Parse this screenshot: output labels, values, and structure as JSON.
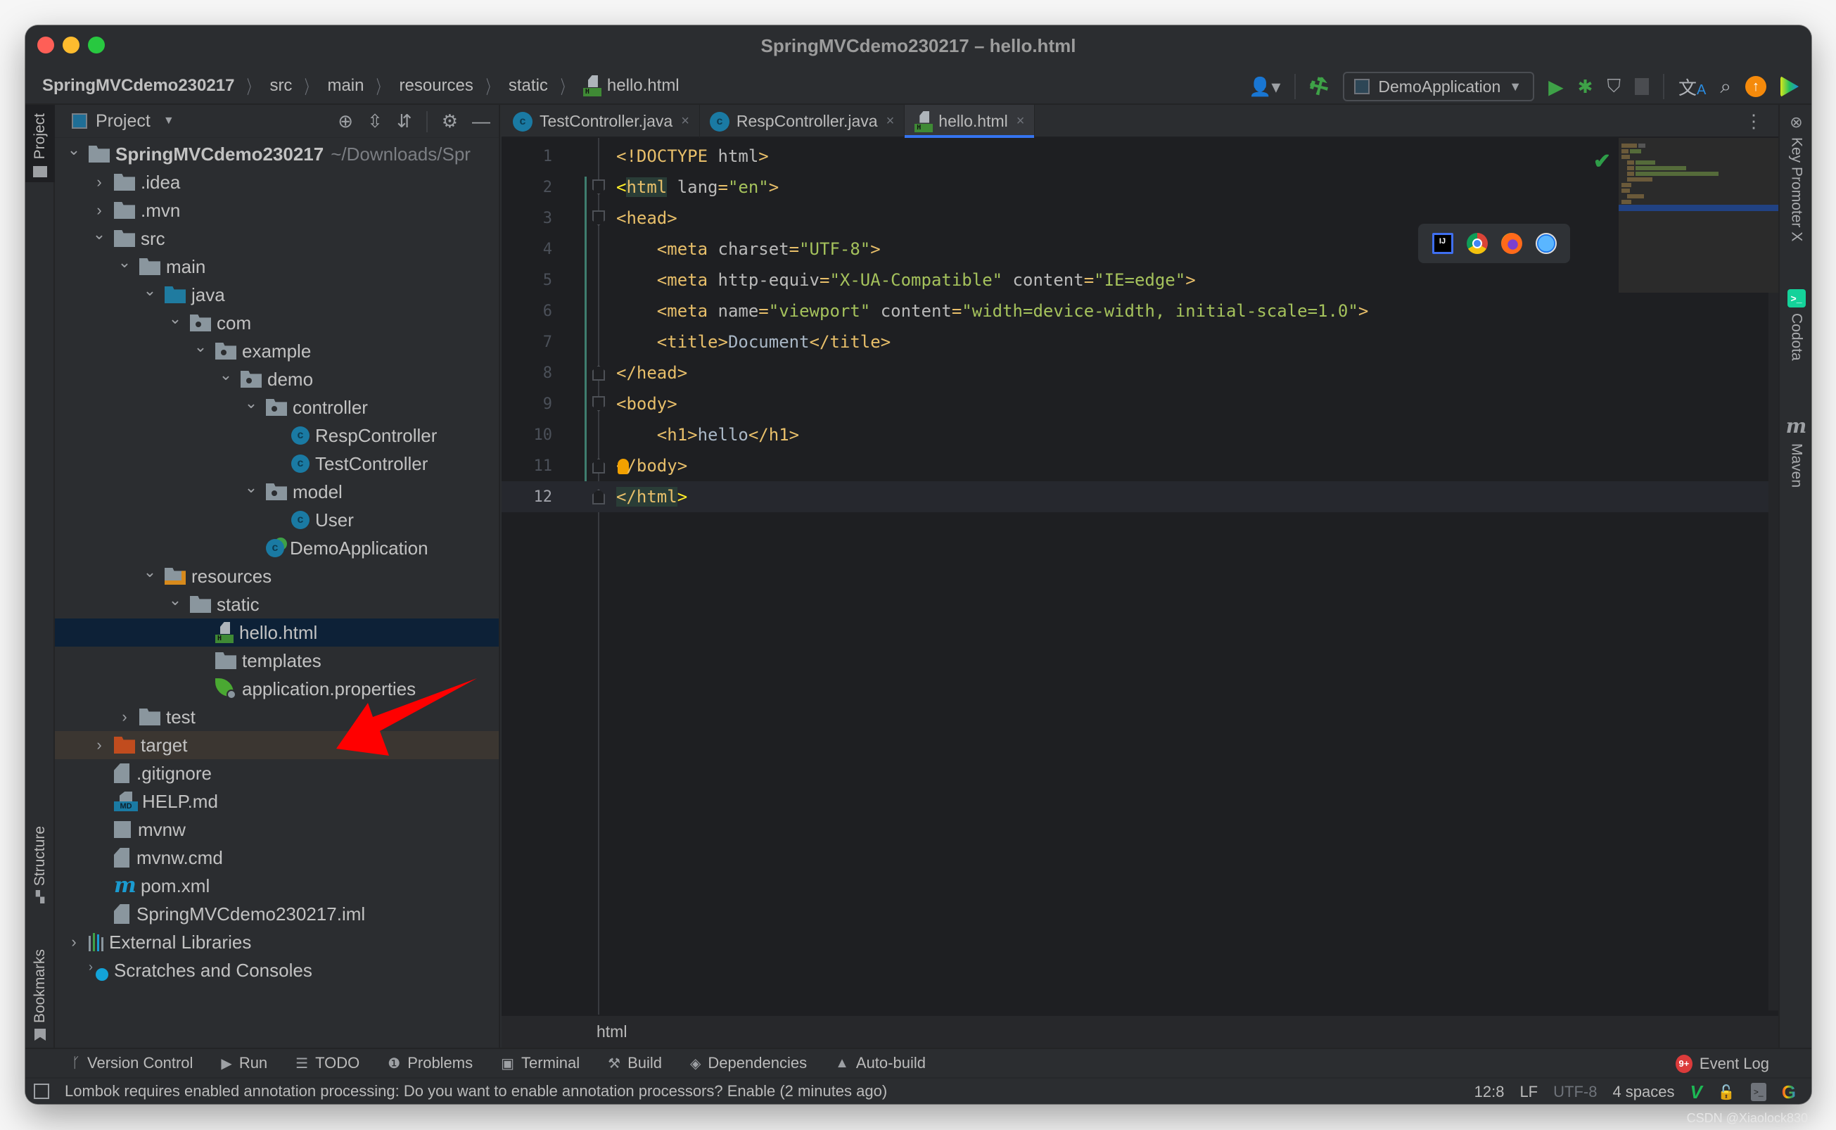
{
  "window": {
    "title": "SpringMVCdemo230217 – hello.html"
  },
  "navbar": {
    "breadcrumbs": [
      "SpringMVCdemo230217",
      "src",
      "main",
      "resources",
      "static",
      "hello.html"
    ],
    "run_config": "DemoApplication"
  },
  "left_stripe": {
    "project": "Project",
    "structure": "Structure",
    "bookmarks": "Bookmarks"
  },
  "right_stripe": {
    "key_promoter": "Key Promoter X",
    "codota": "Codota",
    "maven": "Maven"
  },
  "project_panel": {
    "title": "Project",
    "tree": [
      {
        "label": "SpringMVCdemo230217",
        "suffix": "~/Downloads/Spr",
        "depth": 0,
        "expanded": true,
        "icon": "module-folder"
      },
      {
        "label": ".idea",
        "depth": 1,
        "expanded": false,
        "icon": "folder"
      },
      {
        "label": ".mvn",
        "depth": 1,
        "expanded": false,
        "icon": "folder"
      },
      {
        "label": "src",
        "depth": 1,
        "expanded": true,
        "icon": "folder"
      },
      {
        "label": "main",
        "depth": 2,
        "expanded": true,
        "icon": "folder"
      },
      {
        "label": "java",
        "depth": 3,
        "expanded": true,
        "icon": "source-folder"
      },
      {
        "label": "com",
        "depth": 4,
        "expanded": true,
        "icon": "package"
      },
      {
        "label": "example",
        "depth": 5,
        "expanded": true,
        "icon": "package"
      },
      {
        "label": "demo",
        "depth": 6,
        "expanded": true,
        "icon": "package"
      },
      {
        "label": "controller",
        "depth": 7,
        "expanded": true,
        "icon": "package"
      },
      {
        "label": "RespController",
        "depth": 8,
        "icon": "class"
      },
      {
        "label": "TestController",
        "depth": 8,
        "icon": "class"
      },
      {
        "label": "model",
        "depth": 7,
        "expanded": true,
        "icon": "package"
      },
      {
        "label": "User",
        "depth": 8,
        "icon": "class"
      },
      {
        "label": "DemoApplication",
        "depth": 7,
        "icon": "class-run"
      },
      {
        "label": "resources",
        "depth": 3,
        "expanded": true,
        "icon": "resources-folder"
      },
      {
        "label": "static",
        "depth": 4,
        "expanded": true,
        "icon": "folder"
      },
      {
        "label": "hello.html",
        "depth": 5,
        "icon": "html",
        "selected": true
      },
      {
        "label": "templates",
        "depth": 5,
        "icon": "folder"
      },
      {
        "label": "application.properties",
        "depth": 5,
        "icon": "spring-properties"
      },
      {
        "label": "test",
        "depth": 2,
        "expanded": false,
        "icon": "folder"
      },
      {
        "label": "target",
        "depth": 1,
        "expanded": false,
        "icon": "excluded-folder",
        "excluded": true
      },
      {
        "label": ".gitignore",
        "depth": 1,
        "icon": "ignore-file"
      },
      {
        "label": "HELP.md",
        "depth": 1,
        "icon": "markdown"
      },
      {
        "label": "mvnw",
        "depth": 1,
        "icon": "shell"
      },
      {
        "label": "mvnw.cmd",
        "depth": 1,
        "icon": "text-file"
      },
      {
        "label": "pom.xml",
        "depth": 1,
        "icon": "maven"
      },
      {
        "label": "SpringMVCdemo230217.iml",
        "depth": 1,
        "icon": "iml-file"
      },
      {
        "label": "External Libraries",
        "depth": 0,
        "expanded": false,
        "icon": "libraries"
      },
      {
        "label": "Scratches and Consoles",
        "depth": 0,
        "icon": "scratches"
      }
    ]
  },
  "editor": {
    "tabs": [
      {
        "label": "TestController.java",
        "icon": "class",
        "active": false
      },
      {
        "label": "RespController.java",
        "icon": "class",
        "active": false
      },
      {
        "label": "hello.html",
        "icon": "html",
        "active": true
      }
    ],
    "lines": [
      {
        "n": "1",
        "tokens": [
          [
            "tg",
            "<!DOCTYPE"
          ],
          [
            "at",
            " html"
          ],
          [
            "tg",
            ">"
          ]
        ]
      },
      {
        "n": "2",
        "tokens": [
          [
            "tgy",
            "<"
          ],
          [
            "tgh",
            "html"
          ],
          [
            "at",
            " lang"
          ],
          [
            "tg",
            "="
          ],
          [
            "av",
            "\"en\""
          ],
          [
            "tg",
            ">"
          ]
        ],
        "fold": "open"
      },
      {
        "n": "3",
        "tokens": [
          [
            "tg",
            "<head>"
          ]
        ],
        "fold": "open"
      },
      {
        "n": "4",
        "tokens": [
          [
            "tg",
            "    <meta"
          ],
          [
            "at",
            " charset"
          ],
          [
            "tg",
            "="
          ],
          [
            "av",
            "\"UTF-8\""
          ],
          [
            "tg",
            ">"
          ]
        ]
      },
      {
        "n": "5",
        "tokens": [
          [
            "tg",
            "    <meta"
          ],
          [
            "at",
            " http-equiv"
          ],
          [
            "tg",
            "="
          ],
          [
            "av",
            "\"X-UA-Compatible\""
          ],
          [
            "at",
            " content"
          ],
          [
            "tg",
            "="
          ],
          [
            "av",
            "\"IE=edge\""
          ],
          [
            "tg",
            ">"
          ]
        ]
      },
      {
        "n": "6",
        "tokens": [
          [
            "tg",
            "    <meta"
          ],
          [
            "at",
            " name"
          ],
          [
            "tg",
            "="
          ],
          [
            "av",
            "\"viewport\""
          ],
          [
            "at",
            " content"
          ],
          [
            "tg",
            "="
          ],
          [
            "av",
            "\"width=device-width, initial-scale=1.0\""
          ],
          [
            "tg",
            ">"
          ]
        ]
      },
      {
        "n": "7",
        "tokens": [
          [
            "tg",
            "    <title>"
          ],
          [
            "tx",
            "Document"
          ],
          [
            "tg",
            "</title>"
          ]
        ]
      },
      {
        "n": "8",
        "tokens": [
          [
            "tg",
            "</head>"
          ]
        ],
        "fold": "close"
      },
      {
        "n": "9",
        "tokens": [
          [
            "tg",
            "<body>"
          ]
        ],
        "fold": "open"
      },
      {
        "n": "10",
        "tokens": [
          [
            "tg",
            "    <h1>"
          ],
          [
            "tx",
            "hello"
          ],
          [
            "tg",
            "</h1>"
          ]
        ]
      },
      {
        "n": "11",
        "tokens": [
          [
            "tg",
            "<"
          ],
          [
            "bulb",
            ""
          ],
          [
            "tg",
            "/body>"
          ]
        ],
        "fold": "close"
      },
      {
        "n": "12",
        "tokens": [
          [
            "tgh",
            "</html"
          ],
          [
            "tgy",
            ">"
          ]
        ],
        "fold": "close",
        "current": true
      }
    ],
    "breadcrumb": "html",
    "browser_popup": [
      "intellij-icon",
      "chrome-icon",
      "firefox-icon",
      "safari-icon"
    ]
  },
  "bottom_toolbar": {
    "items": [
      {
        "label": "Version Control",
        "icon": "branch-icon"
      },
      {
        "label": "Run",
        "icon": "run-icon"
      },
      {
        "label": "TODO",
        "icon": "list-icon"
      },
      {
        "label": "Problems",
        "icon": "problems-icon"
      },
      {
        "label": "Terminal",
        "icon": "terminal-icon"
      },
      {
        "label": "Build",
        "icon": "hammer-icon"
      },
      {
        "label": "Dependencies",
        "icon": "layers-icon"
      },
      {
        "label": "Auto-build",
        "icon": "warning-icon"
      }
    ],
    "event_log": {
      "label": "Event Log",
      "badge": "9+"
    }
  },
  "statusbar": {
    "message": "Lombok requires enabled annotation processing: Do you want to enable annotation processors? Enable (2 minutes ago)",
    "position": "12:8",
    "line_separator": "LF",
    "encoding": "UTF-8",
    "indent": "4 spaces"
  },
  "watermark": "CSDN @Xiaolock830",
  "colors": {
    "accent": "#3574f0",
    "tag": "#e8bf6a",
    "attr_value": "#a5c25c",
    "selection": "#0d2137",
    "annotation_arrow": "#ff0000"
  }
}
